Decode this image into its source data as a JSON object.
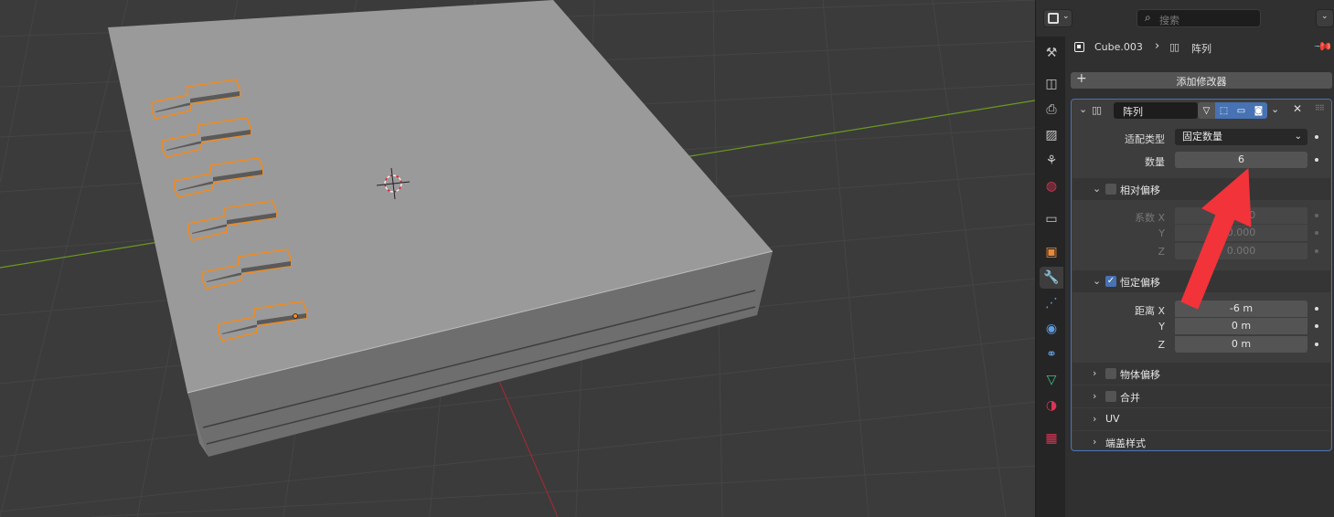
{
  "header": {
    "search_placeholder": "搜索"
  },
  "breadcrumb": {
    "object_name": "Cube.003",
    "modifier_name": "阵列"
  },
  "add_modifier_label": "添加修改器",
  "modifier": {
    "name": "阵列",
    "fit_type_label": "适配类型",
    "fit_type_value": "固定数量",
    "count_label": "数量",
    "count_value": "6",
    "relative_offset": {
      "title": "相对偏移",
      "enabled": false,
      "factor_label_x": "系数 X",
      "label_y": "Y",
      "label_z": "Z",
      "x": "1.000",
      "y": "0.000",
      "z": "0.000"
    },
    "constant_offset": {
      "title": "恒定偏移",
      "enabled": true,
      "distance_label_x": "距离 X",
      "label_y": "Y",
      "label_z": "Z",
      "x": "-6 m",
      "y": "0 m",
      "z": "0 m"
    },
    "subpanels": [
      "物体偏移",
      "合并",
      "UV",
      "端盖样式"
    ]
  },
  "colors": {
    "accent_blue": "#4772b3",
    "selection_orange": "#f28a1c",
    "annotation_arrow": "#f2333a",
    "x_axis": "#9c2a35",
    "y_axis": "#6a9a1f"
  },
  "icons": {
    "tabs": [
      "tool-icon",
      "render-icon",
      "output-icon",
      "view-layer-icon",
      "scene-icon",
      "world-icon",
      "collection-icon",
      "object-icon",
      "modifier-wrench-icon",
      "particles-icon",
      "physics-icon",
      "constraints-icon",
      "data-mesh-icon",
      "material-icon",
      "texture-icon"
    ]
  }
}
